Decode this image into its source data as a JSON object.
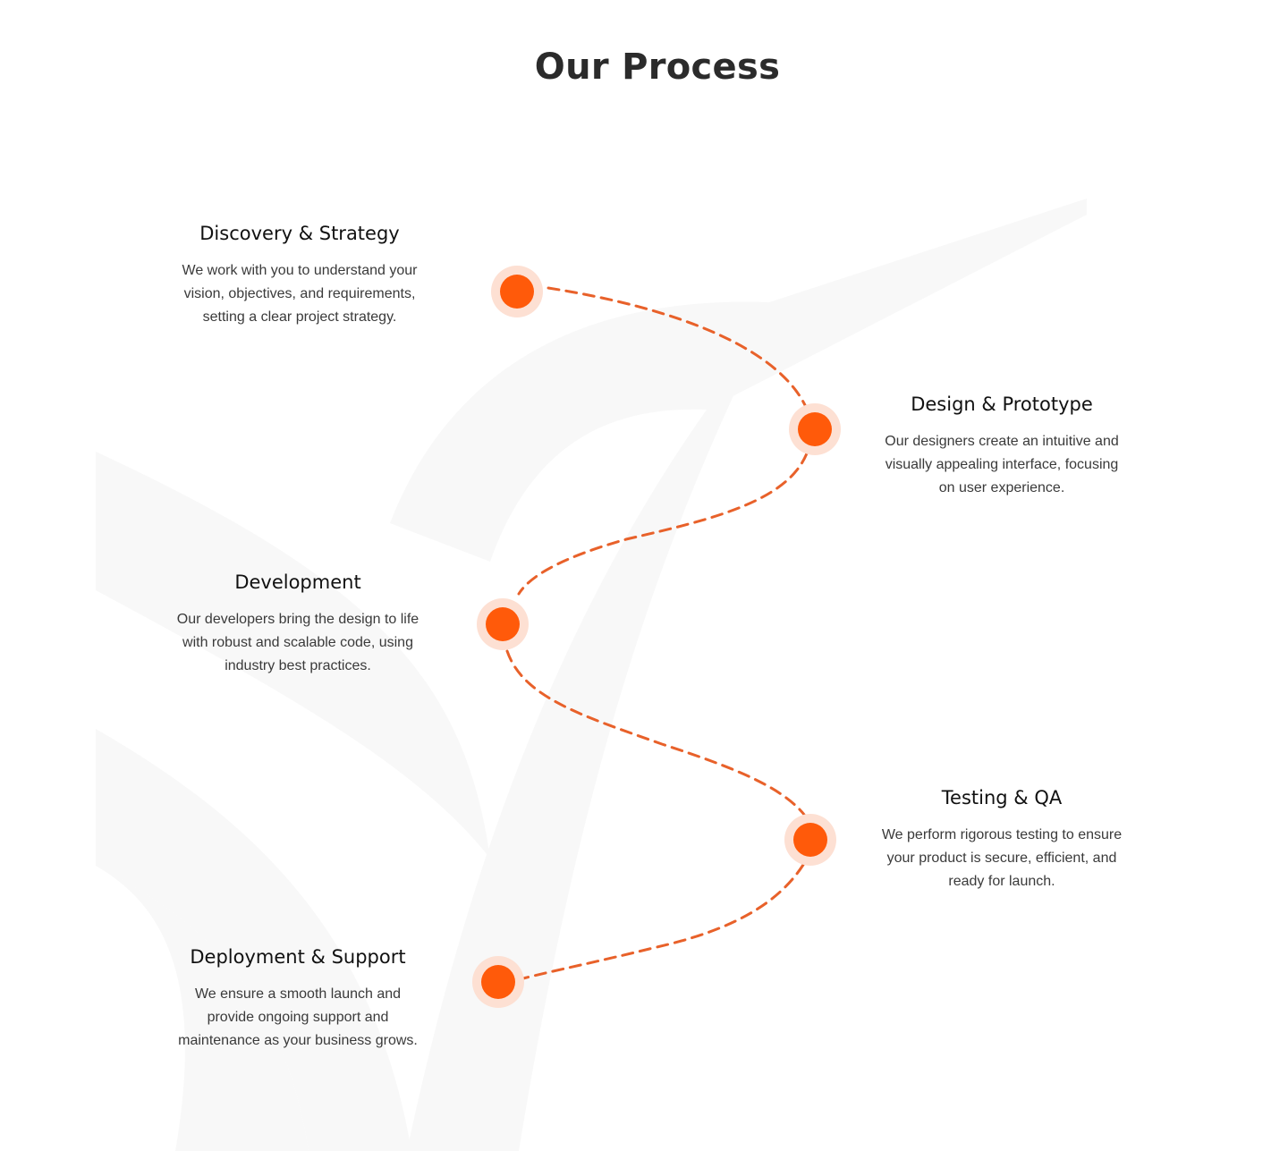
{
  "section": {
    "title": "Our Process"
  },
  "colors": {
    "accent": "#FF5A0A",
    "halo": "#FDE0D3",
    "path": "#E8612A",
    "bg_mark": "#F8F8F8"
  },
  "steps": [
    {
      "title": "Discovery & Strategy",
      "description": "We work with you to understand your vision, objectives, and requirements, setting a clear project strategy."
    },
    {
      "title": "Design & Prototype",
      "description": "Our designers create an intuitive and visually appealing interface, focusing on user experience."
    },
    {
      "title": "Development",
      "description": "Our developers bring the design to life with robust and scalable code, using industry best practices."
    },
    {
      "title": "Testing & QA",
      "description": "We perform rigorous testing to ensure your product is secure, efficient, and ready for launch."
    },
    {
      "title": "Deployment & Support",
      "description": "We ensure a smooth launch and provide ongoing support and maintenance as your business grows."
    }
  ]
}
